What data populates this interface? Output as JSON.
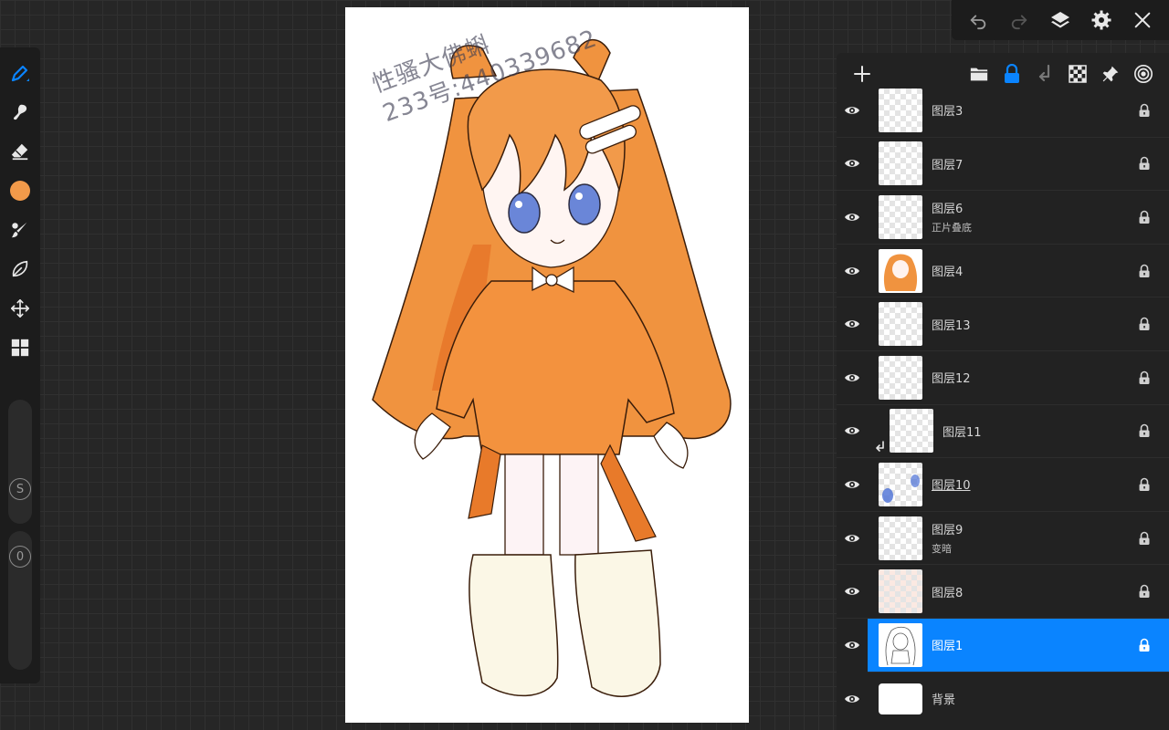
{
  "top_toolbar": {
    "icons": [
      "undo-icon",
      "redo-icon",
      "layers-icon",
      "settings-icon",
      "close-icon"
    ]
  },
  "left_toolbar": {
    "tools": [
      "pen-icon",
      "smudge-icon",
      "eraser-icon",
      "color-swatch",
      "brush-library-icon",
      "lasso-icon",
      "transform-icon",
      "adjust-icon"
    ],
    "active_color": "#f29a4a",
    "accent": "#0a84ff",
    "size_label": "S",
    "opacity_label": "0"
  },
  "canvas": {
    "watermark_line1": "性骚大佛蝌",
    "watermark_line2": "233号:440339682"
  },
  "layers_panel": {
    "header_icons": [
      "add-layer-icon",
      "folder-icon",
      "lock-icon",
      "merge-down-icon",
      "transparency-icon",
      "pin-icon",
      "target-icon"
    ],
    "layers": [
      {
        "name": "图层3",
        "mode": "",
        "selected": false,
        "clipped": false
      },
      {
        "name": "图层7",
        "mode": "",
        "selected": false,
        "clipped": false
      },
      {
        "name": "图层6",
        "mode": "正片叠底",
        "selected": false,
        "clipped": false
      },
      {
        "name": "图层4",
        "mode": "",
        "selected": false,
        "clipped": false
      },
      {
        "name": "图层13",
        "mode": "",
        "selected": false,
        "clipped": false
      },
      {
        "name": "图层12",
        "mode": "",
        "selected": false,
        "clipped": false
      },
      {
        "name": "图层11",
        "mode": "",
        "selected": false,
        "clipped": true
      },
      {
        "name": "图层10",
        "mode": "",
        "selected": false,
        "clipped": false
      },
      {
        "name": "图层9",
        "mode": "变暗",
        "selected": false,
        "clipped": false
      },
      {
        "name": "图层8",
        "mode": "",
        "selected": false,
        "clipped": false
      },
      {
        "name": "图层1",
        "mode": "",
        "selected": true,
        "clipped": false
      },
      {
        "name": "背景",
        "mode": "",
        "selected": false,
        "clipped": false
      }
    ]
  }
}
